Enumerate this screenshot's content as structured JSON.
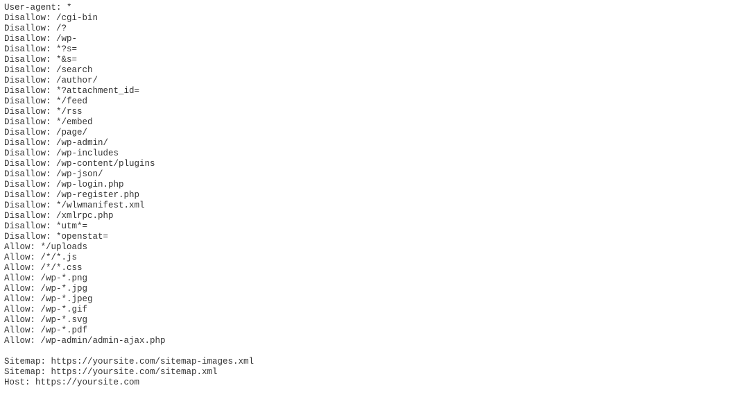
{
  "robots": {
    "user_agent": "*",
    "disallow": [
      "/cgi-bin",
      "/?",
      "/wp-",
      "*?s=",
      "*&s=",
      "/search",
      "/author/",
      "*?attachment_id=",
      "*/feed",
      "*/rss",
      "*/embed",
      "/page/",
      "/wp-admin/",
      "/wp-includes",
      "/wp-content/plugins",
      "/wp-json/",
      "/wp-login.php",
      "/wp-register.php",
      "*/wlwmanifest.xml",
      "/xmlrpc.php",
      "*utm*=",
      "*openstat="
    ],
    "allow": [
      "*/uploads",
      "/*/*.js",
      "/*/*.css",
      "/wp-*.png",
      "/wp-*.jpg",
      "/wp-*.jpeg",
      "/wp-*.gif",
      "/wp-*.svg",
      "/wp-*.pdf",
      "/wp-admin/admin-ajax.php"
    ],
    "sitemaps": [
      "https://yoursite.com/sitemap-images.xml",
      "https://yoursite.com/sitemap.xml"
    ],
    "host": "https://yoursite.com"
  },
  "labels": {
    "user_agent": "User-agent:",
    "disallow": "Disallow:",
    "allow": "Allow:",
    "sitemap": "Sitemap:",
    "host": "Host:"
  }
}
